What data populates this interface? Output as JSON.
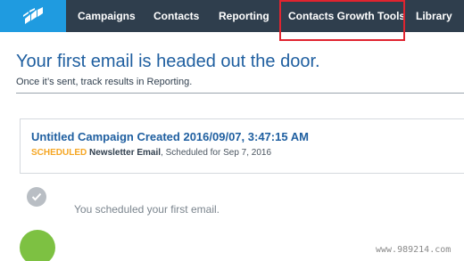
{
  "nav": {
    "items": [
      {
        "label": "Campaigns"
      },
      {
        "label": "Contacts"
      },
      {
        "label": "Reporting"
      },
      {
        "label": "Contacts Growth Tools"
      },
      {
        "label": "Library"
      }
    ],
    "logo_icon": "constant-contact-logo-icon",
    "highlight_color": "#e0242f"
  },
  "main": {
    "headline": "Your first email is headed out the door.",
    "subline": "Once it’s sent, track results in Reporting."
  },
  "campaign_card": {
    "title": "Untitled Campaign Created 2016/09/07, 3:47:15 AM",
    "status": "SCHEDULED",
    "type": "Newsletter Email",
    "schedule": ", Scheduled for Sep 7, 2016"
  },
  "timeline": {
    "event_text": "You scheduled your first email.",
    "event_icon": "check-icon"
  },
  "watermark": "www.989214.com",
  "colors": {
    "nav_bg": "#2f3e4d",
    "logo_bg": "#1f9be0",
    "headline": "#1f5fa0",
    "status": "#f5a623",
    "green": "#7dc142"
  }
}
